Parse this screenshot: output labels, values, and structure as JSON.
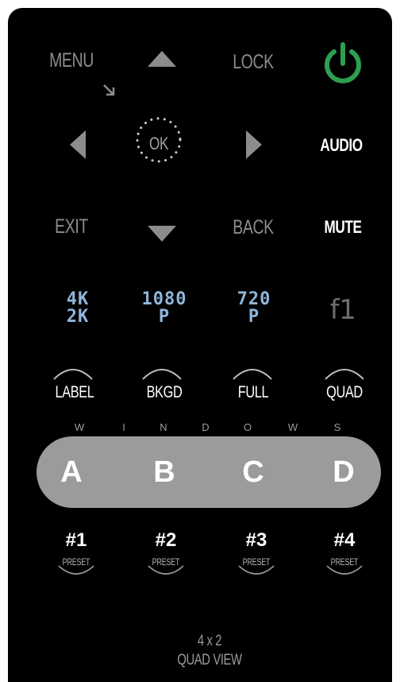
{
  "top": {
    "menu": "MENU",
    "lock": "LOCK",
    "ok": "OK",
    "audio": "AUDIO",
    "exit": "EXIT",
    "back": "BACK",
    "mute": "MUTE"
  },
  "resolutions": {
    "res_4k_line1": "4K",
    "res_4k_line2": "2K",
    "res_1080_line1": "1080",
    "res_1080_line2": "P",
    "res_720_line1": "720",
    "res_720_line2": "P",
    "f1": "f1"
  },
  "modes": {
    "label": "LABEL",
    "bkgd": "BKGD",
    "full": "FULL",
    "quad": "QUAD"
  },
  "windows_letters": [
    "W",
    "I",
    "N",
    "D",
    "O",
    "W",
    "S"
  ],
  "windows": {
    "a": "A",
    "b": "B",
    "c": "C",
    "d": "D"
  },
  "presets": [
    {
      "num": "#1",
      "sub": "PRESET"
    },
    {
      "num": "#2",
      "sub": "PRESET"
    },
    {
      "num": "#3",
      "sub": "PRESET"
    },
    {
      "num": "#4",
      "sub": "PRESET"
    }
  ],
  "footer": {
    "line1": "4 x 2",
    "line2": "QUAD VIEW"
  },
  "colors": {
    "power": "#2e9e4f",
    "background": "#000000",
    "windows_bar": "#9b9b9b",
    "resolution_text": "#8fb6da"
  }
}
